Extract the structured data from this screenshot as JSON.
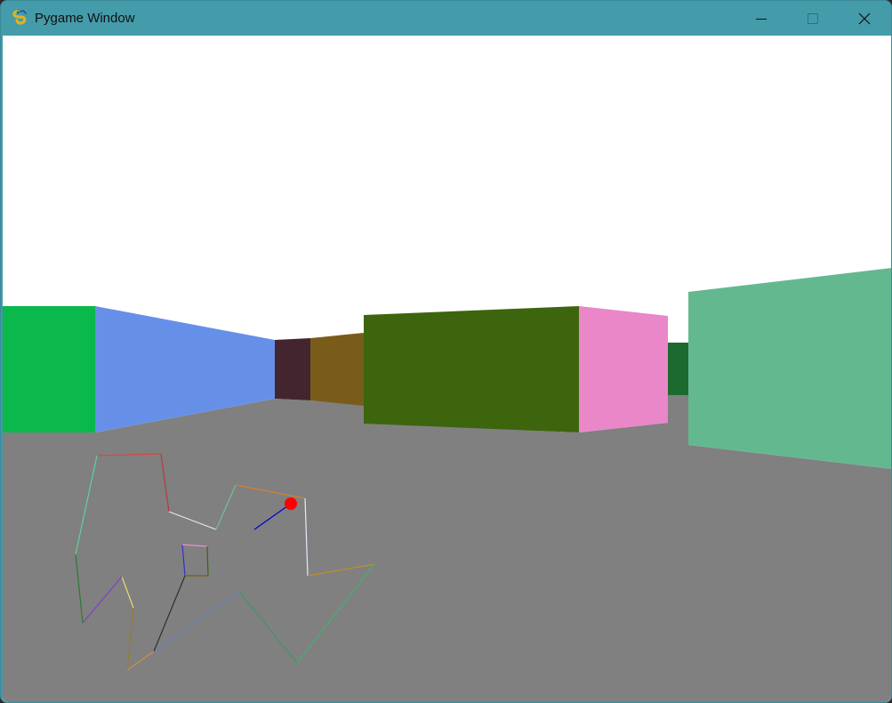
{
  "window": {
    "title": "Pygame Window",
    "controls": {
      "minimize": "minimize",
      "maximize": "maximize",
      "close": "close"
    },
    "icon": "pygame-snake-icon",
    "titlebar_color": "#449baa"
  },
  "scene": {
    "sky_color": "#ffffff",
    "floor_color": "#808080",
    "wall_colors": [
      "#0bb84c",
      "#6690e8",
      "#432530",
      "#7a5c1a",
      "#3d650d",
      "#e987c9",
      "#1c6a30",
      "#64b890"
    ],
    "minimap": {
      "player_color": "#ff0000",
      "direction_color": "#0000cc"
    }
  }
}
